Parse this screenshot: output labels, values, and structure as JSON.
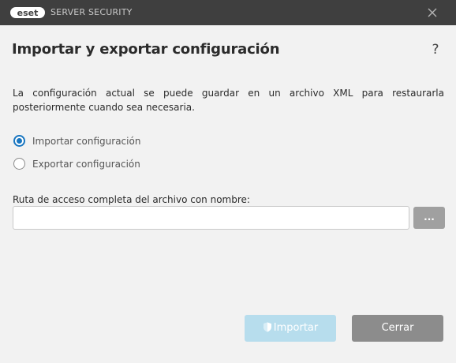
{
  "titlebar": {
    "brand": "eset",
    "product": "SERVER SECURITY"
  },
  "dialog": {
    "title": "Importar y exportar configuración",
    "help_label": "?",
    "description": "La configuración actual se puede guardar en un archivo XML para restaurarla posteriormente cuando sea necesaria.",
    "options": [
      {
        "label": "Importar configuración",
        "selected": true
      },
      {
        "label": "Exportar configuración",
        "selected": false
      }
    ],
    "path_label": "Ruta de acceso completa del archivo con nombre:",
    "path_value": "",
    "browse_label": "..."
  },
  "buttons": {
    "import_label": "Importar",
    "import_enabled": false,
    "close_label": "Cerrar"
  },
  "icons": {
    "close": "close-icon",
    "help": "help-icon",
    "import": "shield-icon"
  },
  "colors": {
    "titlebar": "#3f3f3f",
    "accent": "#1976c0",
    "import_disabled": "#b7dded",
    "close_button": "#8c8c8c",
    "browse_button": "#a0a0a0"
  }
}
